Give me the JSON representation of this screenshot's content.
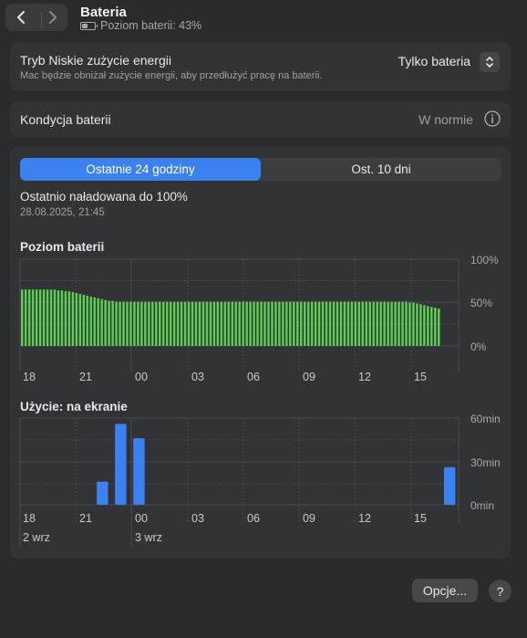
{
  "header": {
    "title": "Bateria",
    "subtitle": "Poziom baterii: 43%",
    "back_icon": "chevron-left-icon",
    "forward_icon": "chevron-right-icon"
  },
  "low_power": {
    "label": "Tryb Niskie zużycie energii",
    "description": "Mac będzie obniżał zużycie energii, aby przedłużyć pracę na baterii.",
    "selected": "Tylko bateria"
  },
  "health": {
    "label": "Kondycja baterii",
    "value": "W normie"
  },
  "tabs": [
    {
      "label": "Ostatnie 24 godziny",
      "selected": true
    },
    {
      "label": "Ost. 10 dni",
      "selected": false
    }
  ],
  "last_charged": {
    "text": "Ostatnio naładowana do 100%",
    "date": "28.08.2025, 21:45"
  },
  "colors": {
    "accent": "#3b82f0",
    "battery_bar": "#5cd053",
    "usage_bar": "#3b82f0"
  },
  "chart_data": [
    {
      "type": "bar",
      "title": "Poziom baterii",
      "y_tick_labels": [
        "100%",
        "50%",
        "0%"
      ],
      "x_tick_labels": [
        "18",
        "21",
        "00",
        "03",
        "06",
        "09",
        "12",
        "15"
      ],
      "ylim": [
        0,
        100
      ],
      "unit": "%",
      "values": [
        65,
        65,
        65,
        65,
        65,
        65,
        65,
        65,
        65,
        65,
        64,
        64,
        63,
        63,
        62,
        61,
        60,
        59,
        58,
        57,
        56,
        55,
        54,
        53,
        52,
        52,
        51,
        51,
        51,
        51,
        51,
        51,
        51,
        51,
        51,
        51,
        51,
        51,
        51,
        51,
        51,
        51,
        51,
        51,
        51,
        51,
        51,
        51,
        51,
        51,
        51,
        51,
        51,
        51,
        51,
        51,
        51,
        51,
        51,
        51,
        51,
        51,
        51,
        51,
        51,
        51,
        51,
        51,
        51,
        51,
        51,
        51,
        51,
        51,
        51,
        51,
        51,
        51,
        51,
        51,
        51,
        51,
        51,
        51,
        51,
        51,
        51,
        51,
        51,
        51,
        51,
        51,
        51,
        51,
        51,
        51,
        51,
        51,
        51,
        51,
        51,
        51,
        51,
        51,
        51,
        51,
        51,
        50,
        50,
        49,
        48,
        47,
        46,
        45,
        44,
        43
      ]
    },
    {
      "type": "bar",
      "title": "Użycie: na ekranie",
      "y_tick_labels": [
        "60min",
        "30min",
        "0min"
      ],
      "x_tick_labels": [
        "18",
        "21",
        "00",
        "03",
        "06",
        "09",
        "12",
        "15"
      ],
      "x_date_labels": [
        "2 wrz",
        "3 wrz"
      ],
      "ylim": [
        0,
        60
      ],
      "unit": "min",
      "categories": [
        "18",
        "19",
        "20",
        "21",
        "22",
        "23",
        "00",
        "01",
        "02",
        "03",
        "04",
        "05",
        "06",
        "07",
        "08",
        "09",
        "10",
        "11",
        "12",
        "13",
        "14",
        "15",
        "16"
      ],
      "values": [
        0,
        0,
        16,
        56,
        46,
        0,
        0,
        0,
        0,
        0,
        0,
        0,
        0,
        0,
        0,
        0,
        0,
        0,
        0,
        0,
        0,
        26,
        0
      ]
    }
  ],
  "footer": {
    "options_label": "Opcje...",
    "help_label": "?"
  }
}
